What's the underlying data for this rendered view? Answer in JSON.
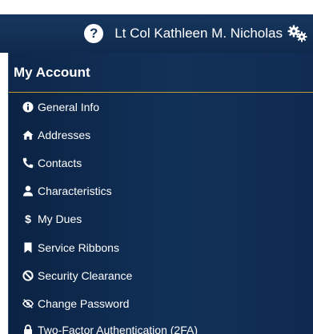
{
  "header": {
    "help_icon_text": "?",
    "user_name": "Lt Col Kathleen M. Nicholas"
  },
  "menu": {
    "title": "My Account",
    "items": [
      {
        "label": "General Info",
        "icon": "info-circle-icon"
      },
      {
        "label": "Addresses",
        "icon": "home-icon"
      },
      {
        "label": "Contacts",
        "icon": "phone-icon"
      },
      {
        "label": "Characteristics",
        "icon": "user-icon"
      },
      {
        "label": "My Dues",
        "icon": "dollar-icon"
      },
      {
        "label": "Service Ribbons",
        "icon": "bookmark-icon"
      },
      {
        "label": "Security Clearance",
        "icon": "ban-icon"
      },
      {
        "label": "Change Password",
        "icon": "eye-slash-icon"
      },
      {
        "label": "Two-Factor Authentication (2FA)",
        "icon": "lock-icon"
      }
    ]
  },
  "colors": {
    "header_bg": "#17365e",
    "menu_bg": "#0f2a52",
    "accent_border": "#c49a2a",
    "text": "#ffffff"
  }
}
